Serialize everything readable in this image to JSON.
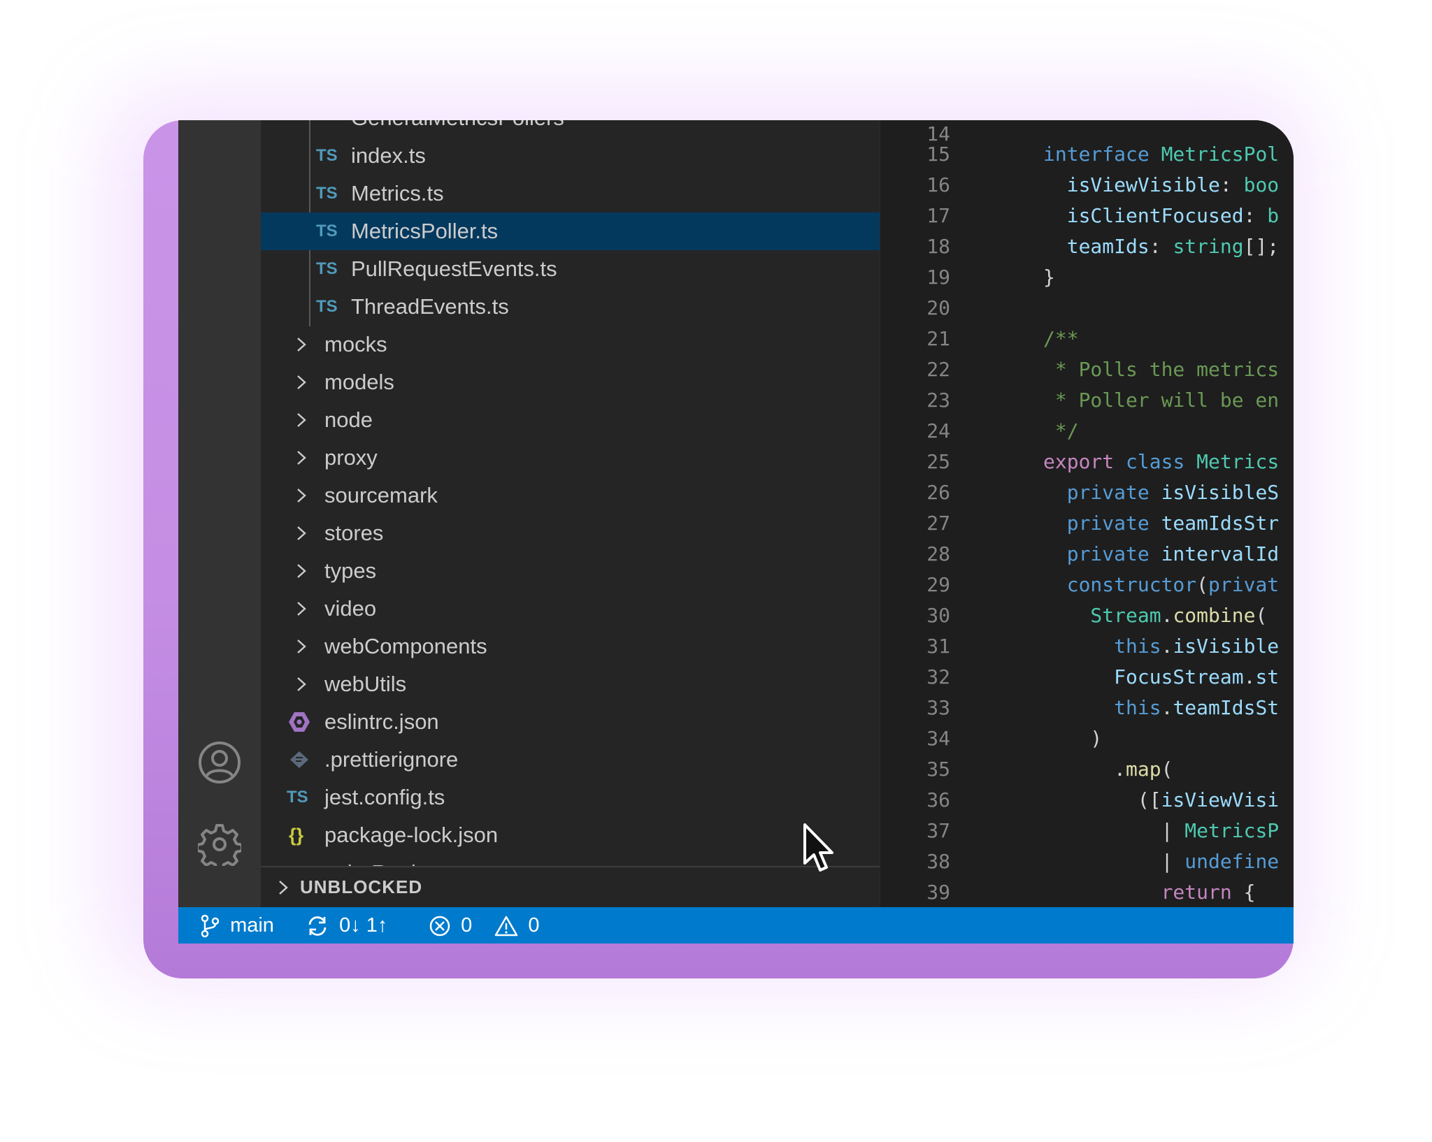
{
  "explorer": {
    "partial_top": "GeneralMetricsPollers",
    "partial_bottom": "colorRegistry",
    "files_nested": [
      {
        "icon": "TS",
        "name": "index.ts",
        "selected": false
      },
      {
        "icon": "TS",
        "name": "Metrics.ts",
        "selected": false
      },
      {
        "icon": "TS",
        "name": "MetricsPoller.ts",
        "selected": true
      },
      {
        "icon": "TS",
        "name": "PullRequestEvents.ts",
        "selected": false
      },
      {
        "icon": "TS",
        "name": "ThreadEvents.ts",
        "selected": false
      }
    ],
    "folders": [
      "mocks",
      "models",
      "node",
      "proxy",
      "sourcemark",
      "stores",
      "types",
      "video",
      "webComponents",
      "webUtils"
    ],
    "root_files": [
      {
        "icon": "eslint-icon",
        "name": "eslintrc.json"
      },
      {
        "icon": "prettier-icon",
        "name": ".prettierignore"
      },
      {
        "icon": "TS",
        "name": "jest.config.ts"
      },
      {
        "icon": "{}",
        "name": "package-lock.json"
      }
    ],
    "section": "UNBLOCKED"
  },
  "editor": {
    "partial_line_top": "14",
    "lines": [
      {
        "n": "15",
        "tokens": [
          [
            "kw",
            "interface "
          ],
          [
            "ty",
            "MetricsPol"
          ]
        ]
      },
      {
        "n": "16",
        "tokens": [
          [
            "pr",
            "  isViewVisible"
          ],
          [
            "pc",
            ": "
          ],
          [
            "ty",
            "boo"
          ]
        ]
      },
      {
        "n": "17",
        "tokens": [
          [
            "pr",
            "  isClientFocused"
          ],
          [
            "pc",
            ": "
          ],
          [
            "ty",
            "b"
          ]
        ]
      },
      {
        "n": "18",
        "tokens": [
          [
            "pr",
            "  teamIds"
          ],
          [
            "pc",
            ": "
          ],
          [
            "ty",
            "string"
          ],
          [
            "pc",
            "[];"
          ]
        ]
      },
      {
        "n": "19",
        "tokens": [
          [
            "pc",
            "}"
          ]
        ]
      },
      {
        "n": "20",
        "tokens": []
      },
      {
        "n": "21",
        "tokens": [
          [
            "cm",
            "/**"
          ]
        ]
      },
      {
        "n": "22",
        "tokens": [
          [
            "cm",
            " * Polls the metrics"
          ]
        ]
      },
      {
        "n": "23",
        "tokens": [
          [
            "cm",
            " * Poller will be en"
          ]
        ]
      },
      {
        "n": "24",
        "tokens": [
          [
            "cm",
            " */"
          ]
        ]
      },
      {
        "n": "25",
        "tokens": [
          [
            "kw2",
            "export "
          ],
          [
            "kw",
            "class "
          ],
          [
            "ty",
            "Metrics"
          ]
        ]
      },
      {
        "n": "26",
        "tokens": [
          [
            "kw",
            "  private "
          ],
          [
            "pr",
            "isVisibleS"
          ]
        ]
      },
      {
        "n": "27",
        "tokens": [
          [
            "kw",
            "  private "
          ],
          [
            "pr",
            "teamIdsStr"
          ]
        ]
      },
      {
        "n": "28",
        "tokens": [
          [
            "kw",
            "  private "
          ],
          [
            "pr",
            "intervalId"
          ]
        ]
      },
      {
        "n": "29",
        "tokens": [
          [
            "kw",
            "  constructor"
          ],
          [
            "pc",
            "("
          ],
          [
            "kw",
            "privat"
          ]
        ]
      },
      {
        "n": "30",
        "tokens": [
          [
            "ty",
            "    Stream"
          ],
          [
            "pc",
            "."
          ],
          [
            "fn",
            "combine"
          ],
          [
            "pc",
            "("
          ]
        ]
      },
      {
        "n": "31",
        "tokens": [
          [
            "kw",
            "      this"
          ],
          [
            "pc",
            "."
          ],
          [
            "pr",
            "isVisible"
          ]
        ]
      },
      {
        "n": "32",
        "tokens": [
          [
            "pr",
            "      FocusStream"
          ],
          [
            "pc",
            "."
          ],
          [
            "pr",
            "st"
          ]
        ]
      },
      {
        "n": "33",
        "tokens": [
          [
            "kw",
            "      this"
          ],
          [
            "pc",
            "."
          ],
          [
            "pr",
            "teamIdsSt"
          ]
        ]
      },
      {
        "n": "34",
        "tokens": [
          [
            "pc",
            "    )"
          ]
        ]
      },
      {
        "n": "35",
        "tokens": [
          [
            "pc",
            "      ."
          ],
          [
            "fn",
            "map"
          ],
          [
            "pc",
            "("
          ]
        ]
      },
      {
        "n": "36",
        "tokens": [
          [
            "pc",
            "        (["
          ],
          [
            "pr",
            "isViewVisi"
          ]
        ]
      },
      {
        "n": "37",
        "tokens": [
          [
            "pc",
            "          | "
          ],
          [
            "ty",
            "MetricsP"
          ]
        ]
      },
      {
        "n": "38",
        "tokens": [
          [
            "pc",
            "          | "
          ],
          [
            "kw",
            "undefine"
          ]
        ]
      },
      {
        "n": "39",
        "tokens": [
          [
            "kw2",
            "          return "
          ],
          [
            "pc",
            "{"
          ]
        ]
      }
    ]
  },
  "status": {
    "branch": "main",
    "sync": "0↓ 1↑",
    "errors": "0",
    "warnings": "0"
  },
  "colors": {
    "status_bar": "#007acc",
    "selection": "#04395e",
    "ts_icon": "#519aba",
    "json_icon": "#cbcb41",
    "eslint_icon": "#a074c4",
    "frame_purple": "#c58ee4"
  }
}
